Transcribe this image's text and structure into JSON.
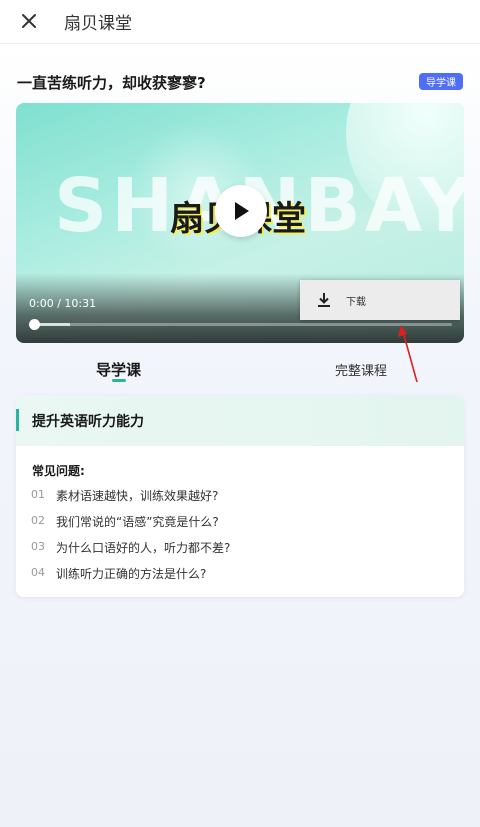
{
  "header": {
    "title": "扇贝课堂",
    "close_icon": "close-icon"
  },
  "headline": "一直苦练听力，却收获寥寥?",
  "badge": "导学课",
  "video": {
    "watermark": "SHANBAY",
    "brand": "扇贝课堂",
    "time": "0:00 / 10:31",
    "progress": 0,
    "buffered_fraction": 0.09,
    "download_label": "下载"
  },
  "tabs": [
    {
      "label": "导学课",
      "active": true
    },
    {
      "label": "完整课程",
      "active": false
    }
  ],
  "card": {
    "title": "提升英语听力能力",
    "faq_title": "常见问题:",
    "faqs": [
      {
        "num": "01",
        "text": "素材语速越快，训练效果越好?"
      },
      {
        "num": "02",
        "text": "我们常说的“语感”究竟是什么?"
      },
      {
        "num": "03",
        "text": "为什么口语好的人，听力都不差?"
      },
      {
        "num": "04",
        "text": "训练听力正确的方法是什么?"
      }
    ]
  },
  "colors": {
    "accent": "#27b4a0",
    "badge": "#4f6ef7",
    "annotation": "#e02020"
  }
}
